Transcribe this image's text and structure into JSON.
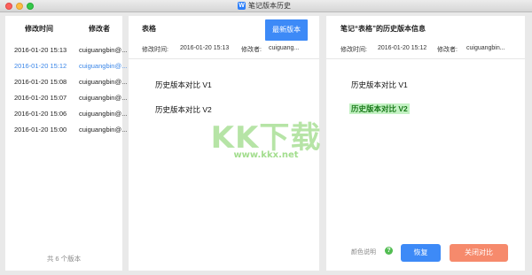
{
  "window": {
    "title": "笔记版本历史",
    "app_icon": "W"
  },
  "history": {
    "header_time": "修改时间",
    "header_author": "修改者",
    "rows": [
      {
        "time": "2016-01-20 15:13",
        "author": "cuiguangbin@..."
      },
      {
        "time": "2016-01-20 15:12",
        "author": "cuiguangbin@...",
        "active": true
      },
      {
        "time": "2016-01-20 15:08",
        "author": "cuiguangbin@..."
      },
      {
        "time": "2016-01-20 15:07",
        "author": "cuiguangbin@..."
      },
      {
        "time": "2016-01-20 15:06",
        "author": "cuiguangbin@..."
      },
      {
        "time": "2016-01-20 15:00",
        "author": "cuiguangbin@..."
      }
    ],
    "footer": "共 6 个版本"
  },
  "middle": {
    "title": "表格",
    "latest_label": "最新版本",
    "time_label": "修改时间:",
    "time_value": "2016-01-20 15:13",
    "author_label": "修改者:",
    "author_value": "cuiguang...",
    "lines": [
      "历史版本对比 V1",
      "历史版本对比 V2"
    ]
  },
  "right": {
    "title": "笔记“表格”的历史版本信息",
    "time_label": "修改时间:",
    "time_value": "2016-01-20 15:12",
    "author_label": "修改者:",
    "author_value": "cuiguangbin...",
    "lines": [
      "历史版本对比 V1",
      "历史版本对比 V2"
    ],
    "color_note": "颜色说明",
    "help_icon": "?",
    "restore_label": "恢复",
    "close_compare_label": "关闭对比"
  },
  "watermark": {
    "big": "KK下载",
    "small": "www.kkx.net"
  },
  "colors": {
    "accent": "#3d8af7",
    "highlight_bg": "#c3f1c3",
    "close_btn": "#f68a6c",
    "active_row": "#3a86e8"
  }
}
